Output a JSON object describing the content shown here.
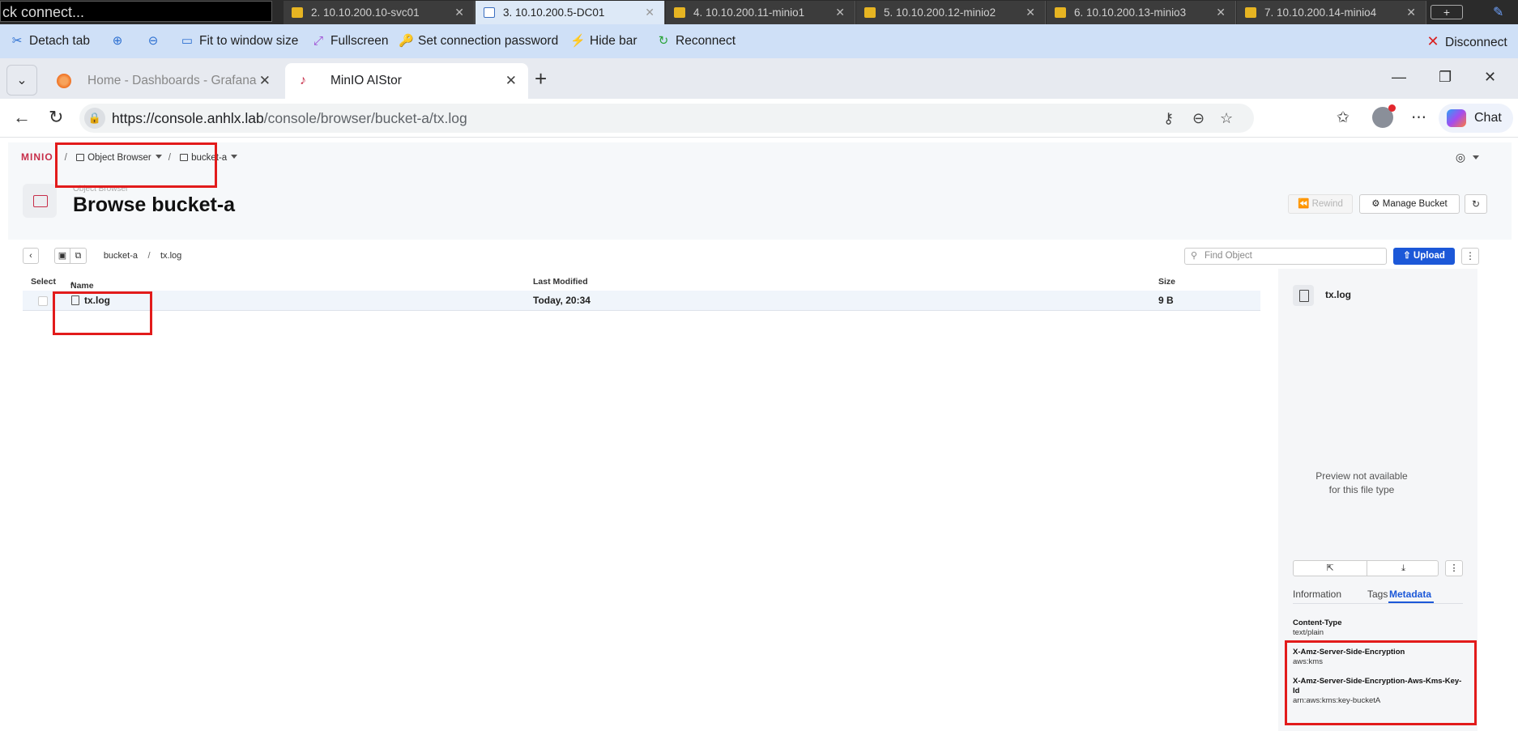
{
  "session_bar": {
    "quick_connect": "ck connect...",
    "tabs": [
      {
        "label": "2. 10.10.200.10-svc01"
      },
      {
        "label": "3. 10.10.200.5-DC01"
      },
      {
        "label": "4. 10.10.200.11-minio1"
      },
      {
        "label": "5. 10.10.200.12-minio2"
      },
      {
        "label": "6. 10.10.200.13-minio3"
      },
      {
        "label": "7. 10.10.200.14-minio4"
      }
    ],
    "add_tab": "+"
  },
  "remote_toolbar": {
    "detach_tab": "Detach tab",
    "fit_to_window": "Fit to window size",
    "fullscreen": "Fullscreen",
    "set_password": "Set connection password",
    "hide_bar": "Hide bar",
    "reconnect": "Reconnect",
    "disconnect": "Disconnect"
  },
  "browser": {
    "tabs": [
      {
        "title": "Home - Dashboards - Grafana"
      },
      {
        "title": "MinIO AIStor"
      }
    ],
    "url_host": "https://console.anhlx.lab",
    "url_path": "/console/browser/bucket-a/tx.log",
    "chat_label": "Chat"
  },
  "minio": {
    "breadcrumb": {
      "logo": "MINIO",
      "object_browser": "Object Browser",
      "bucket": "bucket-a"
    },
    "header": {
      "subtitle": "Object Browser",
      "title": "Browse bucket-a",
      "rewind": "Rewind",
      "manage_bucket": "Manage Bucket"
    },
    "path": {
      "bucket": "bucket-a",
      "file": "tx.log"
    },
    "find_placeholder": "Find Object",
    "upload": "Upload",
    "table": {
      "columns": {
        "select": "Select",
        "name": "Name",
        "modified": "Last Modified",
        "size": "Size"
      },
      "rows": [
        {
          "name": "tx.log",
          "modified": "Today, 20:34",
          "size": "9 B"
        }
      ]
    },
    "details": {
      "filename": "tx.log",
      "preview_note": "Preview not available for this file type",
      "tabs": {
        "information": "Information",
        "tags": "Tags",
        "metadata": "Metadata"
      },
      "metadata": [
        {
          "key": "Content-Type",
          "value": "text/plain"
        },
        {
          "key": "X-Amz-Server-Side-Encryption",
          "value": "aws:kms"
        },
        {
          "key": "X-Amz-Server-Side-Encryption-Aws-Kms-Key-Id",
          "value": "arn:aws:kms:key-bucketA"
        }
      ]
    }
  },
  "colors": {
    "highlight": "#e21b1b",
    "minio_brand": "#c72e49",
    "accent_blue": "#1c58d8"
  }
}
